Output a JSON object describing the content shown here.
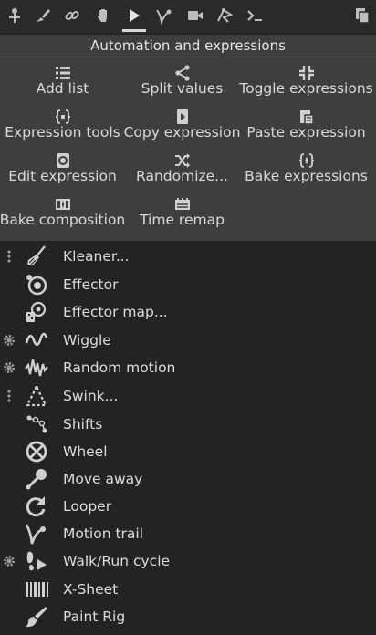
{
  "toolbar": {
    "icons": [
      "pin-tool-icon",
      "rigging-brush-icon",
      "link-chain-icon",
      "hand-icon",
      "play-automation-icon",
      "motion-trail-icon",
      "camera-icon",
      "node-graph-icon",
      "terminal-icon",
      "copy-document-icon"
    ],
    "active": "play-automation-icon"
  },
  "automation": {
    "title": "Automation and expressions",
    "buttons": [
      {
        "label": "Add list",
        "icon": "list-icon"
      },
      {
        "label": "Split values",
        "icon": "share-split-icon"
      },
      {
        "label": "Toggle expressions",
        "icon": "toggle-expressions-icon"
      },
      {
        "label": "Expression tools",
        "icon": "expression-tools-icon"
      },
      {
        "label": "Copy expression",
        "icon": "copy-expression-icon"
      },
      {
        "label": "Paste expression",
        "icon": "paste-expression-icon"
      },
      {
        "label": "Edit expression",
        "icon": "edit-expression-icon"
      },
      {
        "label": "Randomize...",
        "icon": "shuffle-icon"
      },
      {
        "label": "Bake expressions",
        "icon": "bake-expressions-icon"
      },
      {
        "label": "Bake composition",
        "icon": "bake-composition-icon"
      },
      {
        "label": "Time remap",
        "icon": "time-remap-icon"
      }
    ]
  },
  "tools": [
    {
      "label": "Kleaner...",
      "icon": "broom-icon",
      "lead": "more-options-icon"
    },
    {
      "label": "Effector",
      "icon": "effector-icon",
      "lead": ""
    },
    {
      "label": "Effector map...",
      "icon": "effector-map-icon",
      "lead": ""
    },
    {
      "label": "Wiggle",
      "icon": "wiggle-wave-icon",
      "lead": "settings-gear-icon"
    },
    {
      "label": "Random motion",
      "icon": "random-motion-icon",
      "lead": "settings-gear-icon"
    },
    {
      "label": "Swink...",
      "icon": "swink-triangle-icon",
      "lead": "more-options-icon"
    },
    {
      "label": "Shifts",
      "icon": "shifts-icon",
      "lead": ""
    },
    {
      "label": "Wheel",
      "icon": "wheel-icon",
      "lead": ""
    },
    {
      "label": "Move away",
      "icon": "move-away-icon",
      "lead": ""
    },
    {
      "label": "Looper",
      "icon": "looper-icon",
      "lead": ""
    },
    {
      "label": "Motion trail",
      "icon": "motion-trail-icon",
      "lead": ""
    },
    {
      "label": "Walk/Run cycle",
      "icon": "walk-cycle-icon",
      "lead": "settings-gear-icon"
    },
    {
      "label": "X-Sheet",
      "icon": "x-sheet-icon",
      "lead": ""
    },
    {
      "label": "Paint Rig",
      "icon": "paint-brush-icon",
      "lead": ""
    }
  ]
}
